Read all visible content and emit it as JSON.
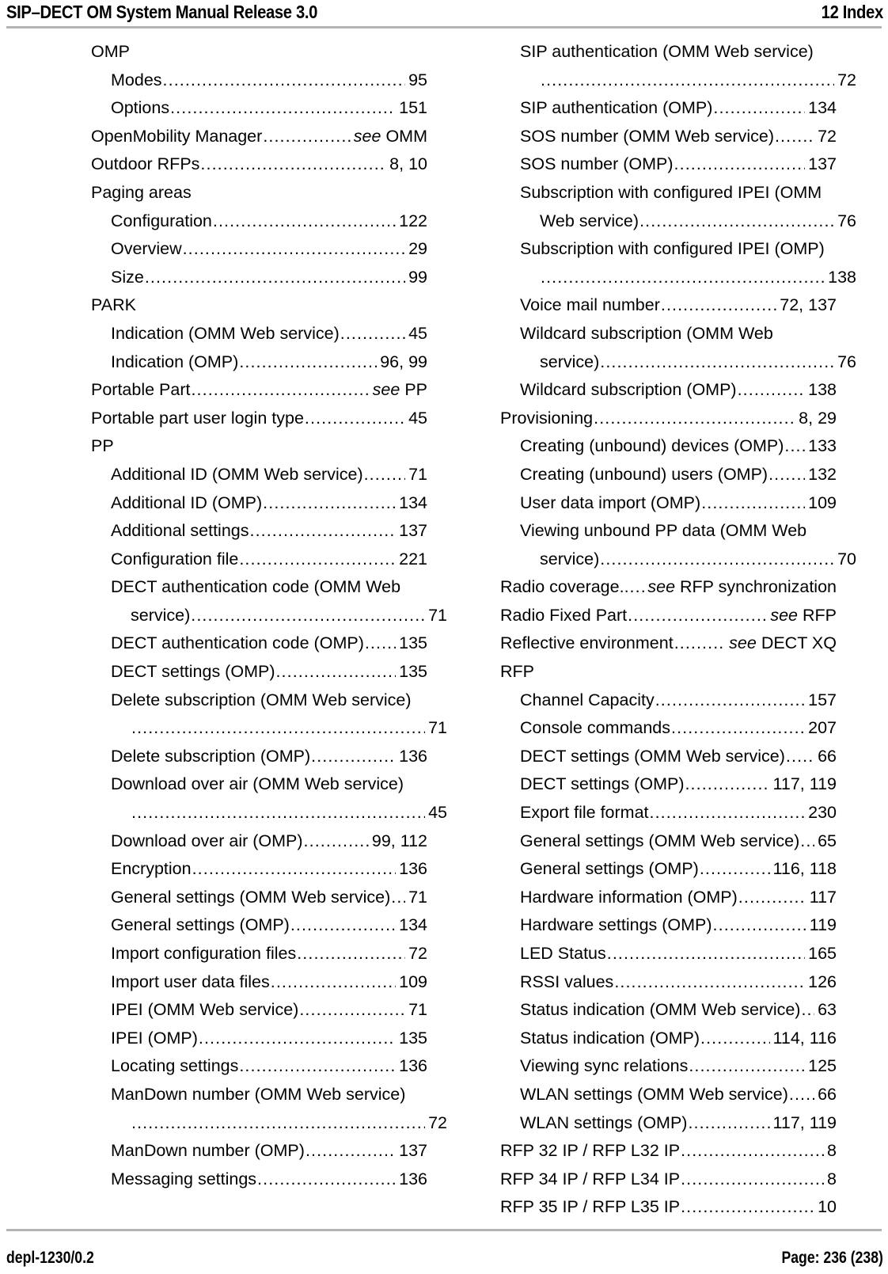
{
  "header": {
    "title": "SIP–DECT OM System Manual Release 3.0",
    "chapter": "12 Index"
  },
  "footer": {
    "doc_id": "depl-1230/0.2",
    "page_label": "Page: 236 (238)"
  },
  "index": {
    "left_column": [
      {
        "level": 0,
        "label": "OMP",
        "page": "",
        "kind": "heading"
      },
      {
        "level": 1,
        "label": "Modes",
        "page": "95",
        "kind": "entry"
      },
      {
        "level": 1,
        "label": "Options",
        "page": "151",
        "kind": "entry"
      },
      {
        "level": 0,
        "label": "OpenMobility Manager",
        "page": "see OMM",
        "kind": "see",
        "see_word": "see",
        "see_target": " OMM"
      },
      {
        "level": 0,
        "label": "Outdoor RFPs",
        "page": "8, 10",
        "kind": "entry"
      },
      {
        "level": 0,
        "label": "Paging areas",
        "page": "",
        "kind": "heading"
      },
      {
        "level": 1,
        "label": "Configuration",
        "page": "122",
        "kind": "entry"
      },
      {
        "level": 1,
        "label": "Overview",
        "page": "29",
        "kind": "entry"
      },
      {
        "level": 1,
        "label": "Size",
        "page": "99",
        "kind": "entry"
      },
      {
        "level": 0,
        "label": "PARK",
        "page": "",
        "kind": "heading"
      },
      {
        "level": 1,
        "label": "Indication (OMM Web service)",
        "page": "45",
        "kind": "entry"
      },
      {
        "level": 1,
        "label": "Indication (OMP)",
        "page": "96, 99",
        "kind": "entry"
      },
      {
        "level": 0,
        "label": "Portable Part",
        "page": "see PP",
        "kind": "see",
        "see_word": "see",
        "see_target": " PP"
      },
      {
        "level": 0,
        "label": "Portable part user login type",
        "page": "45",
        "kind": "entry"
      },
      {
        "level": 0,
        "label": "PP",
        "page": "",
        "kind": "heading"
      },
      {
        "level": 1,
        "label": "Additional ID (OMM Web service)",
        "page": "71",
        "kind": "entry"
      },
      {
        "level": 1,
        "label": "Additional ID (OMP)",
        "page": "134",
        "kind": "entry"
      },
      {
        "level": 1,
        "label": "Additional settings",
        "page": "137",
        "kind": "entry"
      },
      {
        "level": 1,
        "label": "Configuration file",
        "page": "221",
        "kind": "entry"
      },
      {
        "level": 1,
        "label": "DECT authentication code (OMM Web",
        "label2": "service)",
        "page": "71",
        "kind": "wrap"
      },
      {
        "level": 1,
        "label": "DECT authentication code (OMP)",
        "page": "135",
        "kind": "entry"
      },
      {
        "level": 1,
        "label": "DECT settings (OMP)",
        "page": "135",
        "kind": "entry"
      },
      {
        "level": 1,
        "label": "Delete subscription (OMM Web service)",
        "label2": "",
        "page": "71",
        "kind": "wrap"
      },
      {
        "level": 1,
        "label": "Delete subscription (OMP)",
        "page": "136",
        "kind": "entry"
      },
      {
        "level": 1,
        "label": "Download over air (OMM Web service)",
        "label2": "",
        "page": "45",
        "kind": "wrap"
      },
      {
        "level": 1,
        "label": "Download over air (OMP)",
        "page": "99, 112",
        "kind": "entry"
      },
      {
        "level": 1,
        "label": "Encryption",
        "page": "136",
        "kind": "entry"
      },
      {
        "level": 1,
        "label": "General settings (OMM Web service)",
        "page": "71",
        "kind": "entry"
      },
      {
        "level": 1,
        "label": "General settings (OMP)",
        "page": "134",
        "kind": "entry"
      },
      {
        "level": 1,
        "label": "Import configuration files",
        "page": "72",
        "kind": "entry"
      },
      {
        "level": 1,
        "label": "Import user data files",
        "page": "109",
        "kind": "entry"
      },
      {
        "level": 1,
        "label": "IPEI (OMM Web service)",
        "page": "71",
        "kind": "entry"
      },
      {
        "level": 1,
        "label": "IPEI (OMP)",
        "page": "135",
        "kind": "entry"
      },
      {
        "level": 1,
        "label": "Locating settings",
        "page": "136",
        "kind": "entry"
      },
      {
        "level": 1,
        "label": "ManDown number (OMM Web service)",
        "label2": "",
        "page": "72",
        "kind": "wrap"
      },
      {
        "level": 1,
        "label": "ManDown number (OMP)",
        "page": "137",
        "kind": "entry"
      },
      {
        "level": 1,
        "label": "Messaging settings",
        "page": "136",
        "kind": "entry"
      }
    ],
    "right_column": [
      {
        "level": 1,
        "label": "SIP authentication (OMM Web service)",
        "label2": "",
        "page": "72",
        "kind": "wrap"
      },
      {
        "level": 1,
        "label": "SIP authentication (OMP)",
        "page": "134",
        "kind": "entry"
      },
      {
        "level": 1,
        "label": "SOS number (OMM Web service)",
        "page": "72",
        "kind": "entry"
      },
      {
        "level": 1,
        "label": "SOS number (OMP)",
        "page": "137",
        "kind": "entry"
      },
      {
        "level": 1,
        "label": "Subscription with configured IPEI (OMM",
        "label2": "Web service)",
        "page": "76",
        "kind": "wrap"
      },
      {
        "level": 1,
        "label": "Subscription with configured IPEI (OMP)",
        "label2": "",
        "page": "138",
        "kind": "wrap"
      },
      {
        "level": 1,
        "label": "Voice mail number",
        "page": "72, 137",
        "kind": "entry"
      },
      {
        "level": 1,
        "label": "Wildcard subscription (OMM Web",
        "label2": "service)",
        "page": "76",
        "kind": "wrap"
      },
      {
        "level": 1,
        "label": "Wildcard subscription (OMP)",
        "page": "138",
        "kind": "entry"
      },
      {
        "level": 0,
        "label": "Provisioning",
        "page": "8, 29",
        "kind": "entry"
      },
      {
        "level": 1,
        "label": "Creating (unbound) devices (OMP)",
        "page": "133",
        "kind": "entry"
      },
      {
        "level": 1,
        "label": "Creating (unbound) users (OMP)",
        "page": "132",
        "kind": "entry"
      },
      {
        "level": 1,
        "label": "User data import (OMP)",
        "page": "109",
        "kind": "entry"
      },
      {
        "level": 1,
        "label": "Viewing unbound PP data (OMM Web",
        "label2": "service)",
        "page": "70",
        "kind": "wrap"
      },
      {
        "level": 0,
        "label": "Radio coverage..",
        "page": "see RFP synchronization",
        "kind": "see",
        "see_word": "see",
        "see_target": " RFP synchronization"
      },
      {
        "level": 0,
        "label": "Radio Fixed Part",
        "page": "see RFP",
        "kind": "see",
        "see_word": "see",
        "see_target": " RFP"
      },
      {
        "level": 0,
        "label": "Reflective environment",
        "page": "see DECT XQ",
        "kind": "see",
        "see_word": "see",
        "see_target": " DECT XQ"
      },
      {
        "level": 0,
        "label": "RFP",
        "page": "",
        "kind": "heading"
      },
      {
        "level": 1,
        "label": "Channel Capacity",
        "page": "157",
        "kind": "entry"
      },
      {
        "level": 1,
        "label": "Console commands",
        "page": "207",
        "kind": "entry"
      },
      {
        "level": 1,
        "label": "DECT settings (OMM Web service)",
        "page": "66",
        "kind": "entry"
      },
      {
        "level": 1,
        "label": "DECT settings (OMP)",
        "page": "117, 119",
        "kind": "entry"
      },
      {
        "level": 1,
        "label": "Export file format",
        "page": "230",
        "kind": "entry"
      },
      {
        "level": 1,
        "label": "General settings (OMM Web service)",
        "page": "65",
        "kind": "entry"
      },
      {
        "level": 1,
        "label": "General settings (OMP)",
        "page": "116, 118",
        "kind": "entry"
      },
      {
        "level": 1,
        "label": "Hardware information (OMP)",
        "page": "117",
        "kind": "entry"
      },
      {
        "level": 1,
        "label": "Hardware settings (OMP)",
        "page": "119",
        "kind": "entry"
      },
      {
        "level": 1,
        "label": "LED Status",
        "page": "165",
        "kind": "entry"
      },
      {
        "level": 1,
        "label": "RSSI values",
        "page": "126",
        "kind": "entry"
      },
      {
        "level": 1,
        "label": "Status indication (OMM Web service)",
        "page": "63",
        "kind": "entry"
      },
      {
        "level": 1,
        "label": "Status indication (OMP)",
        "page": "114, 116",
        "kind": "entry"
      },
      {
        "level": 1,
        "label": "Viewing sync relations",
        "page": "125",
        "kind": "entry"
      },
      {
        "level": 1,
        "label": "WLAN settings (OMM Web service)",
        "page": "66",
        "kind": "entry"
      },
      {
        "level": 1,
        "label": "WLAN settings (OMP)",
        "page": "117, 119",
        "kind": "entry"
      },
      {
        "level": 0,
        "label": "RFP 32 IP / RFP L32 IP",
        "page": "8",
        "kind": "entry"
      },
      {
        "level": 0,
        "label": "RFP 34 IP / RFP L34 IP",
        "page": "8",
        "kind": "entry"
      },
      {
        "level": 0,
        "label": "RFP 35 IP / RFP L35 IP",
        "page": "10",
        "kind": "entry"
      }
    ]
  }
}
